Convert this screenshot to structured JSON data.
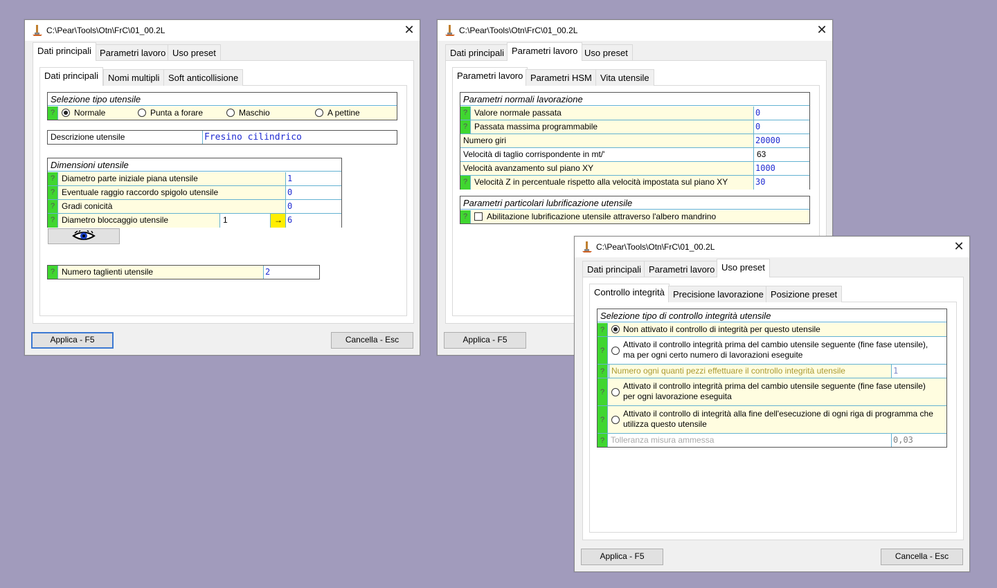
{
  "w1": {
    "title": "C:\\Pear\\Tools\\Otn\\FrC\\01_00.2L",
    "close": "✕",
    "tabs": [
      "Dati principali",
      "Parametri lavoro",
      "Uso preset"
    ],
    "subtabs": [
      "Dati principali",
      "Nomi multipli",
      "Soft anticollisione"
    ],
    "sel_header": "Selezione tipo utensile",
    "q": "?",
    "radios": [
      "Normale",
      "Punta a forare",
      "Maschio",
      "A pettine"
    ],
    "descr_label": "Descrizione utensile",
    "descr_value": "Fresino cilindrico",
    "dim_header": "Dimensioni utensile",
    "dim_rows": [
      {
        "label": "Diametro parte iniziale piana utensile",
        "value": "1"
      },
      {
        "label": "Eventuale raggio raccordo spigolo utensile",
        "value": "0"
      },
      {
        "label": "Gradi conicità",
        "value": "0"
      },
      {
        "label": "Diametro bloccaggio utensile",
        "value": "6",
        "mid": "1",
        "arrow": "→"
      }
    ],
    "tagli_label": "Numero taglienti utensile",
    "tagli_value": "2",
    "apply": "Applica - F5",
    "cancel": "Cancella - Esc"
  },
  "w2": {
    "title": "C:\\Pear\\Tools\\Otn\\FrC\\01_00.2L",
    "close": "✕",
    "tabs": [
      "Dati principali",
      "Parametri lavoro",
      "Uso preset"
    ],
    "subtabs": [
      "Parametri lavoro",
      "Parametri HSM",
      "Vita utensile"
    ],
    "norm_header": "Parametri normali lavorazione",
    "rows": [
      {
        "label": "Valore normale passata",
        "value": "0",
        "q": true
      },
      {
        "label": "Passata massima programmabile",
        "value": "0",
        "q": true
      },
      {
        "label": "Numero giri",
        "value": "20000",
        "q": false
      },
      {
        "label": "Velocità di taglio corrispondente in mt/'",
        "value": "63",
        "q": false
      },
      {
        "label": "Velocità avanzamento sul piano XY",
        "value": "1000",
        "q": false
      },
      {
        "label": "Velocità Z in percentuale rispetto alla velocità impostata sul piano XY",
        "value": "30",
        "q": true
      }
    ],
    "lub_header": "Parametri particolari lubrificazione utensile",
    "lub_label": "Abilitazione lubrificazione utensile attraverso l'albero mandrino",
    "apply": "Applica - F5"
  },
  "w3": {
    "title": "C:\\Pear\\Tools\\Otn\\FrC\\01_00.2L",
    "close": "✕",
    "tabs": [
      "Dati principali",
      "Parametri lavoro",
      "Uso preset"
    ],
    "subtabs": [
      "Controllo integrità",
      "Precisione lavorazione",
      "Posizione preset"
    ],
    "header": "Selezione tipo di controllo integrità utensile",
    "opt1": "Non attivato il controllo di integrità per questo utensile",
    "opt2a": "Attivato il controllo integrità prima del cambio utensile seguente (fine fase utensile),",
    "opt2b": "ma per ogni certo numero di lavorazioni eseguite",
    "num_label": "Numero ogni quanti pezzi effettuare il controllo integrità utensile",
    "num_value": "1",
    "opt3a": "Attivato il controllo integrità prima del cambio utensile seguente (fine fase utensile)",
    "opt3b": "per ogni lavorazione eseguita",
    "opt4a": "Attivato il controllo di integrità alla fine dell'esecuzione di ogni riga di programma che",
    "opt4b": "utilizza questo utensile",
    "tol_label": "Tolleranza misura ammessa",
    "tol_value": "0,03",
    "apply": "Applica - F5",
    "cancel": "Cancella - Esc"
  }
}
